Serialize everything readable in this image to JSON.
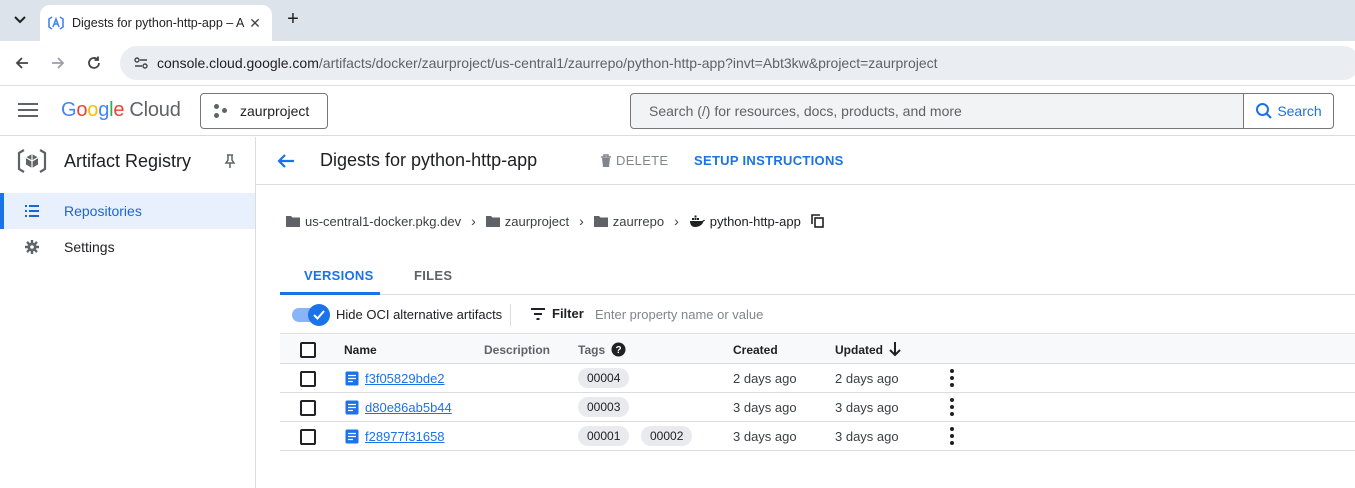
{
  "browser": {
    "tab_title": "Digests for python-http-app – A",
    "url_host": "console.cloud.google.com",
    "url_path": "/artifacts/docker/zaurproject/us-central1/zaurrepo/python-http-app?invt=Abt3kw&project=zaurproject"
  },
  "header": {
    "logo_google": [
      "G",
      "o",
      "o",
      "g",
      "l",
      "e"
    ],
    "logo_cloud": "Cloud",
    "project": "zaurproject",
    "search_placeholder": "Search (/) for resources, docs, products, and more",
    "search_button": "Search"
  },
  "sidebar": {
    "product": "Artifact Registry",
    "items": [
      {
        "label": "Repositories",
        "active": true
      },
      {
        "label": "Settings",
        "active": false
      }
    ]
  },
  "page": {
    "title": "Digests for python-http-app",
    "delete_label": "DELETE",
    "setup_label": "SETUP INSTRUCTIONS"
  },
  "breadcrumb": [
    "us-central1-docker.pkg.dev",
    "zaurproject",
    "zaurrepo",
    "python-http-app"
  ],
  "tabs": [
    "VERSIONS",
    "FILES"
  ],
  "filters": {
    "toggle_label": "Hide OCI alternative artifacts",
    "toggle_on": true,
    "filter_label": "Filter",
    "filter_placeholder": "Enter property name or value"
  },
  "table": {
    "columns": [
      "Name",
      "Description",
      "Tags",
      "Created",
      "Updated"
    ],
    "rows": [
      {
        "name": "f3f05829bde2",
        "tags": [
          "00004"
        ],
        "created": "2 days ago",
        "updated": "2 days ago"
      },
      {
        "name": "d80e86ab5b44",
        "tags": [
          "00003"
        ],
        "created": "3 days ago",
        "updated": "3 days ago"
      },
      {
        "name": "f28977f31658",
        "tags": [
          "00001",
          "00002"
        ],
        "created": "3 days ago",
        "updated": "3 days ago"
      }
    ]
  },
  "colors": {
    "accent": "#1a73e8",
    "active_bg": "#e8f0fe",
    "chrome_bg": "#dde3ea"
  }
}
